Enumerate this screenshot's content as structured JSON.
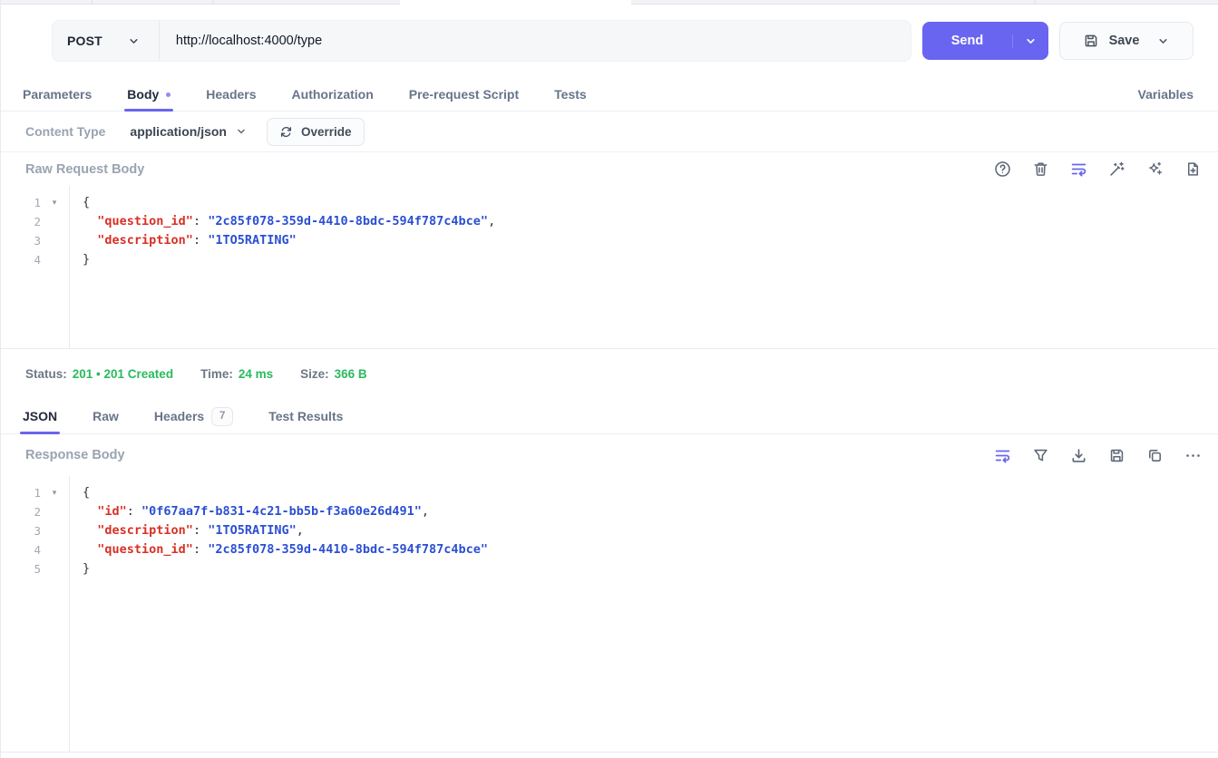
{
  "topbar": {
    "method": "POST",
    "url": "http://localhost:4000/type",
    "send_label": "Send",
    "save_label": "Save"
  },
  "request_tabs": {
    "items": [
      "Parameters",
      "Body",
      "Headers",
      "Authorization",
      "Pre-request Script",
      "Tests"
    ],
    "active": "Body",
    "variables_label": "Variables"
  },
  "content_type": {
    "label": "Content Type",
    "value": "application/json",
    "override_label": "Override"
  },
  "request_body_section": {
    "title": "Raw Request Body",
    "toolbar_icons": [
      "help-icon",
      "delete-icon",
      "wrap-text-icon",
      "prettify-wand-icon",
      "ai-sparkles-icon",
      "import-file-icon"
    ]
  },
  "request_editor": {
    "lines": [
      {
        "num": "1",
        "fold": true,
        "tokens": [
          {
            "t": "p",
            "v": "{"
          }
        ]
      },
      {
        "num": "2",
        "fold": false,
        "tokens": [
          {
            "t": "p",
            "v": "  "
          },
          {
            "t": "k",
            "v": "\"question_id\""
          },
          {
            "t": "p",
            "v": ": "
          },
          {
            "t": "s",
            "v": "\"2c85f078-359d-4410-8bdc-594f787c4bce\""
          },
          {
            "t": "p",
            "v": ","
          }
        ]
      },
      {
        "num": "3",
        "fold": false,
        "tokens": [
          {
            "t": "p",
            "v": "  "
          },
          {
            "t": "k",
            "v": "\"description\""
          },
          {
            "t": "p",
            "v": ": "
          },
          {
            "t": "s",
            "v": "\"1TO5RATING\""
          }
        ]
      },
      {
        "num": "4",
        "fold": false,
        "tokens": [
          {
            "t": "p",
            "v": "}"
          }
        ]
      }
    ]
  },
  "status_bar": {
    "status_label": "Status:",
    "status_value": "201  •  201 Created",
    "time_label": "Time:",
    "time_value": "24 ms",
    "size_label": "Size:",
    "size_value": "366 B"
  },
  "response_tabs": {
    "items": [
      "JSON",
      "Raw",
      "Headers",
      "Test Results"
    ],
    "active": "JSON",
    "headers_count": "7"
  },
  "response_body_section": {
    "title": "Response Body",
    "toolbar_icons": [
      "wrap-text-icon",
      "filter-icon",
      "download-icon",
      "save-response-icon",
      "copy-icon",
      "more-options-icon"
    ]
  },
  "response_editor": {
    "lines": [
      {
        "num": "1",
        "fold": true,
        "tokens": [
          {
            "t": "p",
            "v": "{"
          }
        ]
      },
      {
        "num": "2",
        "fold": false,
        "tokens": [
          {
            "t": "p",
            "v": "  "
          },
          {
            "t": "k",
            "v": "\"id\""
          },
          {
            "t": "p",
            "v": ": "
          },
          {
            "t": "s",
            "v": "\"0f67aa7f-b831-4c21-bb5b-f3a60e26d491\""
          },
          {
            "t": "p",
            "v": ","
          }
        ]
      },
      {
        "num": "3",
        "fold": false,
        "tokens": [
          {
            "t": "p",
            "v": "  "
          },
          {
            "t": "k",
            "v": "\"description\""
          },
          {
            "t": "p",
            "v": ": "
          },
          {
            "t": "s",
            "v": "\"1TO5RATING\""
          },
          {
            "t": "p",
            "v": ","
          }
        ]
      },
      {
        "num": "4",
        "fold": false,
        "tokens": [
          {
            "t": "p",
            "v": "  "
          },
          {
            "t": "k",
            "v": "\"question_id\""
          },
          {
            "t": "p",
            "v": ": "
          },
          {
            "t": "s",
            "v": "\"2c85f078-359d-4410-8bdc-594f787c4bce\""
          }
        ]
      },
      {
        "num": "5",
        "fold": false,
        "tokens": [
          {
            "t": "p",
            "v": "}"
          }
        ]
      }
    ]
  },
  "colors": {
    "accent": "#6965f1",
    "success_green": "#2aba5e",
    "code_key_red": "#d93025",
    "code_string_blue": "#2b4fd3"
  }
}
